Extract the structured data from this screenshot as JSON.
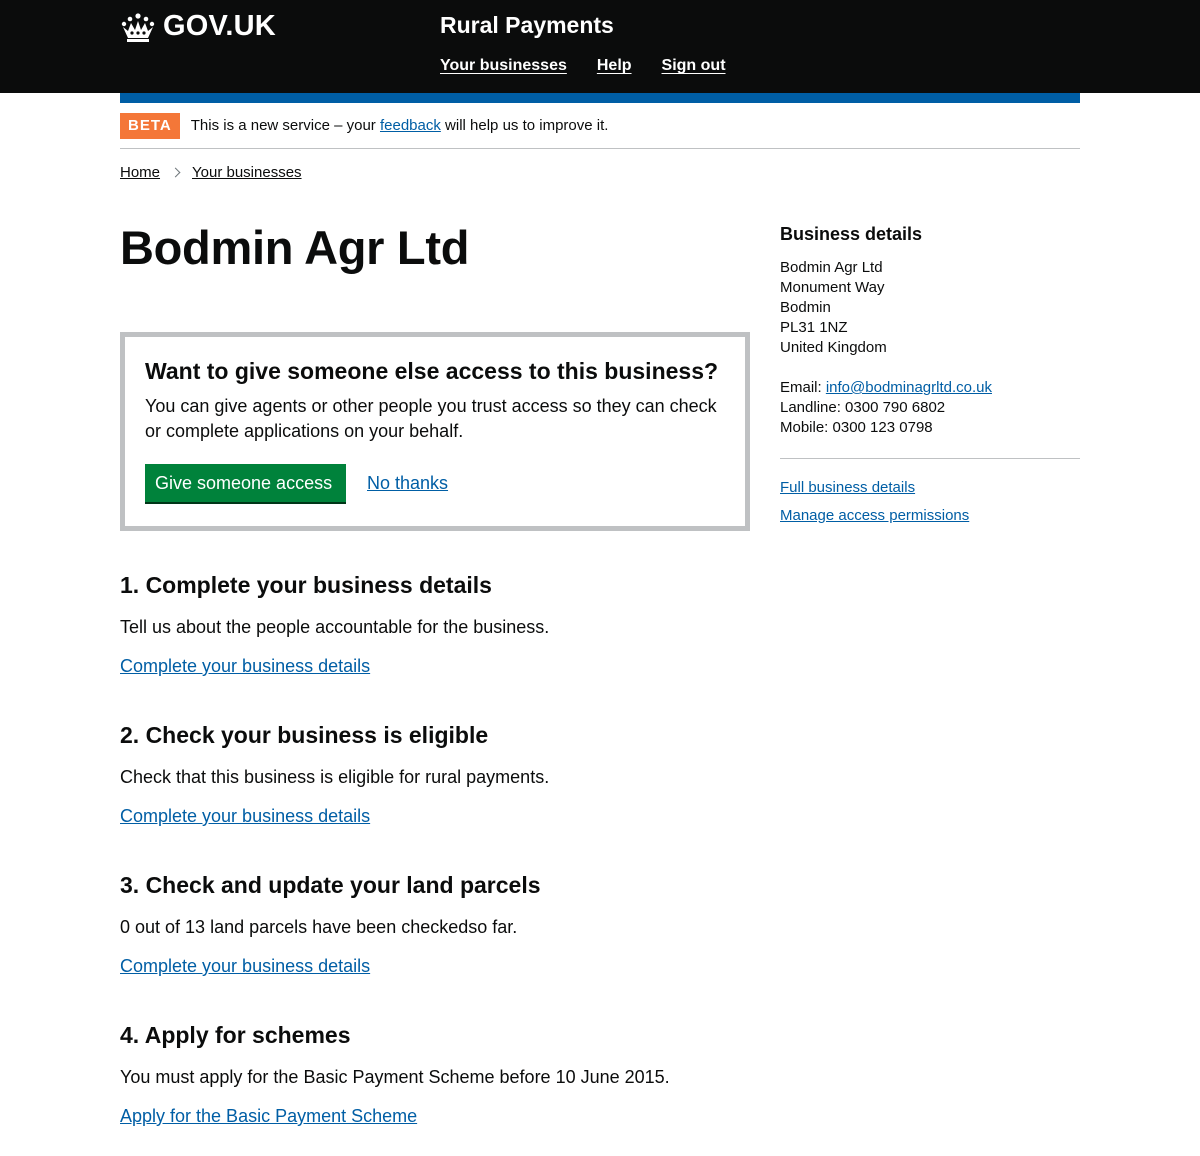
{
  "header": {
    "logo_text": "GOV.UK",
    "service_name": "Rural Payments",
    "nav": [
      "Your businesses",
      "Help",
      "Sign out"
    ]
  },
  "phase_banner": {
    "tag": "BETA",
    "text_before": "This is a new service – your ",
    "link": "feedback",
    "text_after": " will help us to improve it."
  },
  "breadcrumb": [
    "Home",
    "Your businesses"
  ],
  "page_title": "Bodmin Agr Ltd",
  "panel": {
    "heading": "Want to give someone else access to this business?",
    "body": "You can give agents or other people you trust access so they can check or complete applications on your behalf.",
    "primary_button": "Give someone access",
    "secondary_link": "No thanks"
  },
  "steps": [
    {
      "heading": "1. Complete your business details",
      "body": "Tell us about the people accountable for the business.",
      "link": "Complete your business details"
    },
    {
      "heading": "2. Check your business is eligible",
      "body": "Check that this business is eligible for rural payments.",
      "link": "Complete your business details"
    },
    {
      "heading": "3. Check and update your land parcels",
      "body": "0 out of 13 land parcels have been checkedso far.",
      "link": "Complete your business details"
    },
    {
      "heading": "4. Apply for schemes",
      "body": "You must apply for the Basic Payment Scheme before 10 June 2015.",
      "link": "Apply for the Basic Payment Scheme"
    }
  ],
  "sidebar": {
    "heading": "Business details",
    "address": [
      "Bodmin Agr Ltd",
      "Monument Way",
      "Bodmin",
      "PL31 1NZ",
      "United Kingdom"
    ],
    "email_label": "Email: ",
    "email": "info@bodminagrltd.co.uk",
    "landline": "Landline: 0300 790 6802",
    "mobile": "Mobile: 0300 123 0798",
    "links": [
      "Full business details",
      "Manage access permissions"
    ]
  },
  "colors": {
    "header_bg": "#0b0c0c",
    "brand_blue": "#005ea5",
    "beta_orange": "#f47738",
    "button_green": "#00823b",
    "panel_border": "#bfc1c3"
  },
  "icons": {
    "logo": "crown-icon",
    "breadcrumb_separator": "chevron-right-icon"
  }
}
